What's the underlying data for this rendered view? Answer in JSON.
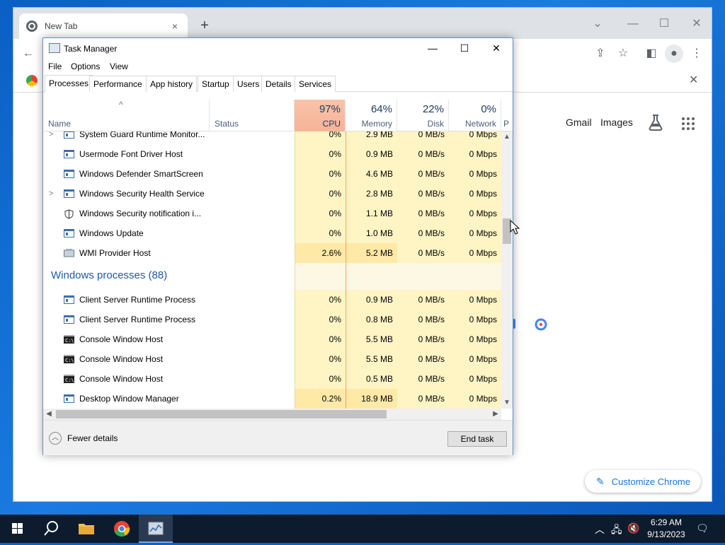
{
  "chrome": {
    "tab_title": "New Tab",
    "tab_close": "×",
    "new_tab": "+",
    "header_links": {
      "gmail": "Gmail",
      "images": "Images"
    },
    "customize_label": "Customize Chrome"
  },
  "task_manager": {
    "title": "Task Manager",
    "menu": [
      "File",
      "Options",
      "View"
    ],
    "tabs": [
      "Processes",
      "Performance",
      "App history",
      "Startup",
      "Users",
      "Details",
      "Services"
    ],
    "active_tab": "Processes",
    "columns": {
      "name": "Name",
      "status": "Status",
      "cpu": {
        "pct": "97%",
        "label": "CPU"
      },
      "memory": {
        "pct": "64%",
        "label": "Memory"
      },
      "disk": {
        "pct": "22%",
        "label": "Disk"
      },
      "network": {
        "pct": "0%",
        "label": "Network"
      },
      "power_partial": "P"
    },
    "rows_app": [
      {
        "name": "System Guard Runtime Monitor...",
        "expandable": true,
        "icon": "service-icon",
        "cpu": "0%",
        "memory": "2.9 MB",
        "disk": "0 MB/s",
        "network": "0 Mbps"
      },
      {
        "name": "Usermode Font Driver Host",
        "expandable": false,
        "icon": "service-icon",
        "cpu": "0%",
        "memory": "0.9 MB",
        "disk": "0 MB/s",
        "network": "0 Mbps"
      },
      {
        "name": "Windows Defender SmartScreen",
        "expandable": false,
        "icon": "service-icon",
        "cpu": "0%",
        "memory": "4.6 MB",
        "disk": "0 MB/s",
        "network": "0 Mbps"
      },
      {
        "name": "Windows Security Health Service",
        "expandable": true,
        "icon": "service-icon",
        "cpu": "0%",
        "memory": "2.8 MB",
        "disk": "0 MB/s",
        "network": "0 Mbps"
      },
      {
        "name": "Windows Security notification i...",
        "expandable": false,
        "icon": "shield-icon",
        "cpu": "0%",
        "memory": "1.1 MB",
        "disk": "0 MB/s",
        "network": "0 Mbps"
      },
      {
        "name": "Windows Update",
        "expandable": false,
        "icon": "service-icon",
        "cpu": "0%",
        "memory": "1.0 MB",
        "disk": "0 MB/s",
        "network": "0 Mbps"
      },
      {
        "name": "WMI Provider Host",
        "expandable": false,
        "icon": "wmi-icon",
        "cpu": "2.6%",
        "memory": "5.2 MB",
        "disk": "0 MB/s",
        "network": "0 Mbps"
      }
    ],
    "group_label": "Windows processes (88)",
    "rows_win": [
      {
        "name": "Client Server Runtime Process",
        "icon": "service-icon",
        "cpu": "0%",
        "memory": "0.9 MB",
        "disk": "0 MB/s",
        "network": "0 Mbps"
      },
      {
        "name": "Client Server Runtime Process",
        "icon": "service-icon",
        "cpu": "0%",
        "memory": "0.8 MB",
        "disk": "0 MB/s",
        "network": "0 Mbps"
      },
      {
        "name": "Console Window Host",
        "icon": "console-icon",
        "cpu": "0%",
        "memory": "5.5 MB",
        "disk": "0 MB/s",
        "network": "0 Mbps"
      },
      {
        "name": "Console Window Host",
        "icon": "console-icon",
        "cpu": "0%",
        "memory": "5.5 MB",
        "disk": "0 MB/s",
        "network": "0 Mbps"
      },
      {
        "name": "Console Window Host",
        "icon": "console-icon",
        "cpu": "0%",
        "memory": "0.5 MB",
        "disk": "0 MB/s",
        "network": "0 Mbps"
      },
      {
        "name": "Desktop Window Manager",
        "icon": "service-icon",
        "cpu": "0.2%",
        "memory": "18.9 MB",
        "disk": "0 MB/s",
        "network": "0 Mbps"
      }
    ],
    "fewer_details": "Fewer details",
    "end_task": "End task"
  },
  "taskbar": {
    "time": "6:29 AM",
    "date": "9/13/2023"
  }
}
